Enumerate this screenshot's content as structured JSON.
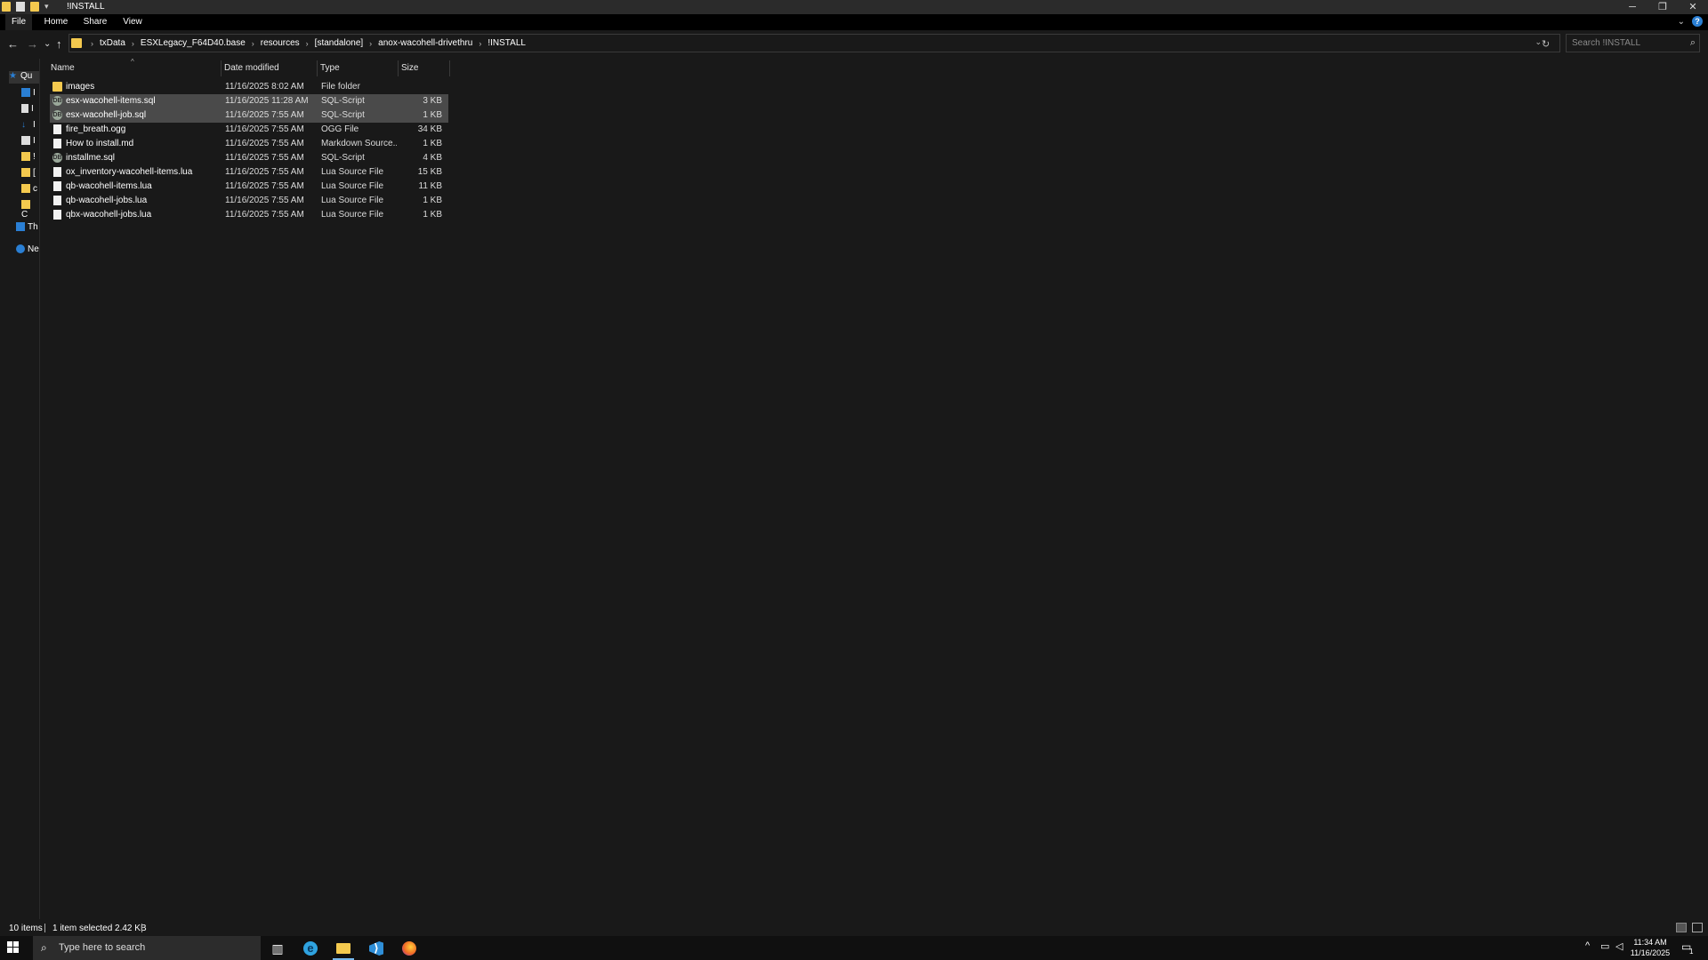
{
  "window": {
    "title": "!INSTALL",
    "qat_arrow": "▾",
    "controls": {
      "minimize": "─",
      "restore": "❐",
      "close": "✕"
    }
  },
  "ribbon": {
    "tabs": [
      {
        "label": "File",
        "active": true
      },
      {
        "label": "Home",
        "active": false
      },
      {
        "label": "Share",
        "active": false
      },
      {
        "label": "View",
        "active": false
      }
    ],
    "expand_glyph": "⌄",
    "help_glyph": "?"
  },
  "nav": {
    "back": "←",
    "forward": "→",
    "recent": "⌄",
    "up": "↑"
  },
  "address": {
    "crumbs": [
      "txData",
      "ESXLegacy_F64D40.base",
      "resources",
      "[standalone]",
      "anox-wacohell-drivethru",
      "!INSTALL"
    ],
    "separator": "›",
    "dropdown_glyph": "⌄",
    "refresh_glyph": "↻"
  },
  "search": {
    "placeholder": "Search !INSTALL",
    "icon": "⌕"
  },
  "navpane": {
    "items": [
      {
        "label": "Qu",
        "icon": "star-icon",
        "color": "#2a7fd4"
      },
      {
        "label": "I",
        "icon": "desktop-icon",
        "color": "#2a7fd4"
      },
      {
        "label": "I",
        "icon": "document-icon",
        "color": "#dddddd"
      },
      {
        "label": "I",
        "icon": "download-icon",
        "color": "#2a7fd4"
      },
      {
        "label": "I",
        "icon": "pictures-icon",
        "color": "#dddddd"
      },
      {
        "label": "!",
        "icon": "folder-icon",
        "color": "#f4c94e"
      },
      {
        "label": "[",
        "icon": "folder-icon",
        "color": "#f4c94e"
      },
      {
        "label": "c",
        "icon": "folder-icon",
        "color": "#f4c94e"
      },
      {
        "label": "C",
        "icon": "folder-icon",
        "color": "#f4c94e"
      },
      {
        "label": "Th",
        "icon": "computer-icon",
        "color": "#2a7fd4"
      },
      {
        "label": "Ne",
        "icon": "network-icon",
        "color": "#2a7fd4"
      }
    ]
  },
  "columns": {
    "name": "Name",
    "date": "Date modified",
    "type": "Type",
    "size": "Size",
    "sort_glyph": "^"
  },
  "files": [
    {
      "name": "images",
      "date": "11/16/2025 8:02 AM",
      "type": "File folder",
      "size": "",
      "icon": "folder-icon",
      "selected": false
    },
    {
      "name": "esx-wacohell-items.sql",
      "date": "11/16/2025 11:28 AM",
      "type": "SQL-Script",
      "size": "3 KB",
      "icon": "sql-file-icon",
      "selected": true
    },
    {
      "name": "esx-wacohell-job.sql",
      "date": "11/16/2025 7:55 AM",
      "type": "SQL-Script",
      "size": "1 KB",
      "icon": "sql-file-icon",
      "selected": true
    },
    {
      "name": "fire_breath.ogg",
      "date": "11/16/2025 7:55 AM",
      "type": "OGG File",
      "size": "34 KB",
      "icon": "file-icon",
      "selected": false
    },
    {
      "name": "How to install.md",
      "date": "11/16/2025 7:55 AM",
      "type": "Markdown Source...",
      "size": "1 KB",
      "icon": "markdown-file-icon",
      "selected": false
    },
    {
      "name": "installme.sql",
      "date": "11/16/2025 7:55 AM",
      "type": "SQL-Script",
      "size": "4 KB",
      "icon": "sql-file-icon",
      "selected": false
    },
    {
      "name": "ox_inventory-wacohell-items.lua",
      "date": "11/16/2025 7:55 AM",
      "type": "Lua Source File",
      "size": "15 KB",
      "icon": "file-icon",
      "selected": false
    },
    {
      "name": "qb-wacohell-items.lua",
      "date": "11/16/2025 7:55 AM",
      "type": "Lua Source File",
      "size": "11 KB",
      "icon": "file-icon",
      "selected": false
    },
    {
      "name": "qb-wacohell-jobs.lua",
      "date": "11/16/2025 7:55 AM",
      "type": "Lua Source File",
      "size": "1 KB",
      "icon": "file-icon",
      "selected": false
    },
    {
      "name": "qbx-wacohell-jobs.lua",
      "date": "11/16/2025 7:55 AM",
      "type": "Lua Source File",
      "size": "1 KB",
      "icon": "file-icon",
      "selected": false
    }
  ],
  "status": {
    "count": "10 items",
    "selection": "1 item selected  2.42 KB"
  },
  "taskbar": {
    "search_placeholder": "Type here to search",
    "search_icon": "⌕",
    "apps": [
      {
        "name": "task-view-icon",
        "glyph": "▥",
        "color": "#ffffff",
        "active": false
      },
      {
        "name": "edge-icon",
        "glyph": "e",
        "color": "#2fa3e0",
        "active": false
      },
      {
        "name": "file-explorer-icon",
        "glyph": "",
        "color": "#f4c94e",
        "active": true
      },
      {
        "name": "vscode-icon",
        "glyph": "⟩",
        "color": "#2f8fd8",
        "active": false
      },
      {
        "name": "firefox-icon",
        "glyph": "",
        "color": "#f06a25",
        "active": false
      }
    ],
    "tray": {
      "chevron": "^",
      "network": "▭",
      "volume": "◁"
    },
    "time": "11:34 AM",
    "date": "11/16/2025",
    "notification_count": "1"
  }
}
